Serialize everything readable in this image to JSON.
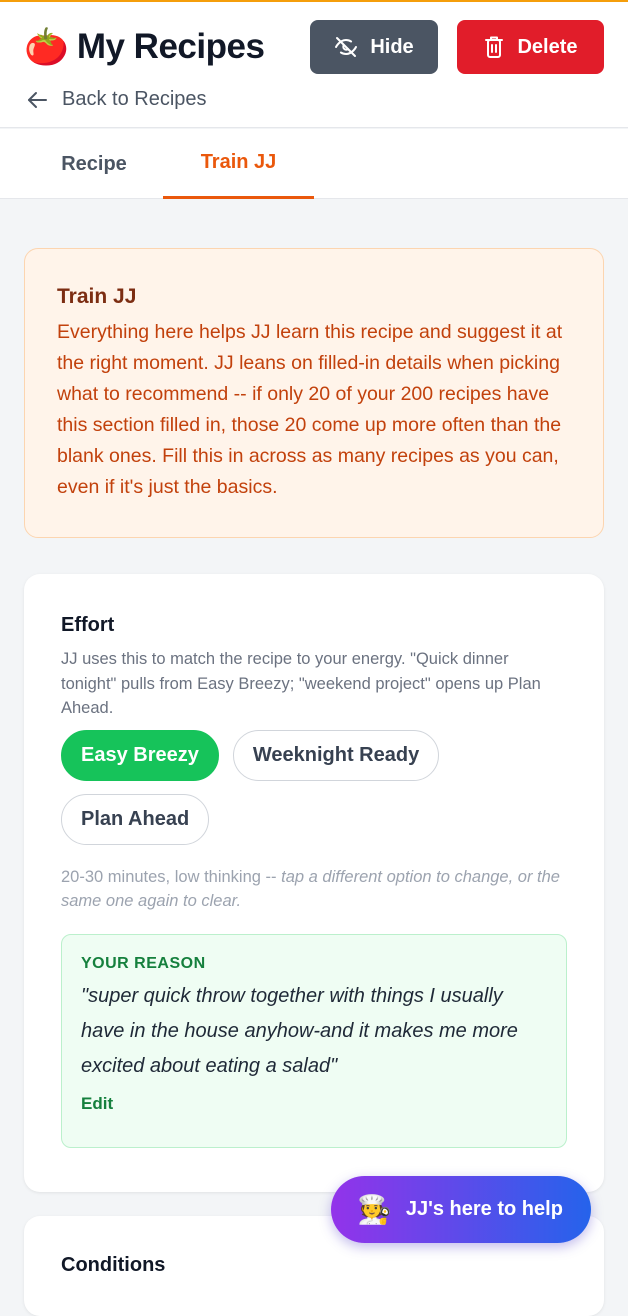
{
  "header": {
    "logo_emoji": "🍅",
    "app_title": "My Recipes",
    "hide_label": "Hide",
    "delete_label": "Delete",
    "back_label": "Back to Recipes"
  },
  "tabs": [
    {
      "label": "Recipe",
      "active": false
    },
    {
      "label": "Train JJ",
      "active": true
    }
  ],
  "info": {
    "title": "Train JJ",
    "body": "Everything here helps JJ learn this recipe and suggest it at the right moment. JJ leans on filled-in details when picking what to recommend -- if only 20 of your 200 recipes have this section filled in, those 20 come up more often than the blank ones. Fill this in across as many recipes as you can, even if it's just the basics."
  },
  "effort": {
    "title": "Effort",
    "description": "JJ uses this to match the recipe to your energy. \"Quick dinner tonight\" pulls from Easy Breezy; \"weekend project\" opens up Plan Ahead.",
    "options": [
      {
        "label": "Easy Breezy",
        "selected": true
      },
      {
        "label": "Weeknight Ready",
        "selected": false
      },
      {
        "label": "Plan Ahead",
        "selected": false
      }
    ],
    "hint_main": "20-30 minutes, low thinking -- ",
    "hint_italic": "tap a different option to change, or the same one again to clear.",
    "reason_label": "YOUR REASON",
    "reason_text": "\"super quick throw together with things I usually have in the house anyhow-and it makes me more excited about eating a salad\"",
    "edit_label": "Edit"
  },
  "conditions": {
    "title": "Conditions"
  },
  "fab": {
    "chef_emoji": "🧑‍🍳",
    "label": "JJ's here to help"
  },
  "colors": {
    "accent_orange": "#ea580c",
    "hide_button": "#4b5563",
    "delete_button": "#e11d2a",
    "selected_green": "#16c35a",
    "fab_gradient_start": "#9333ea",
    "fab_gradient_end": "#2563eb"
  }
}
